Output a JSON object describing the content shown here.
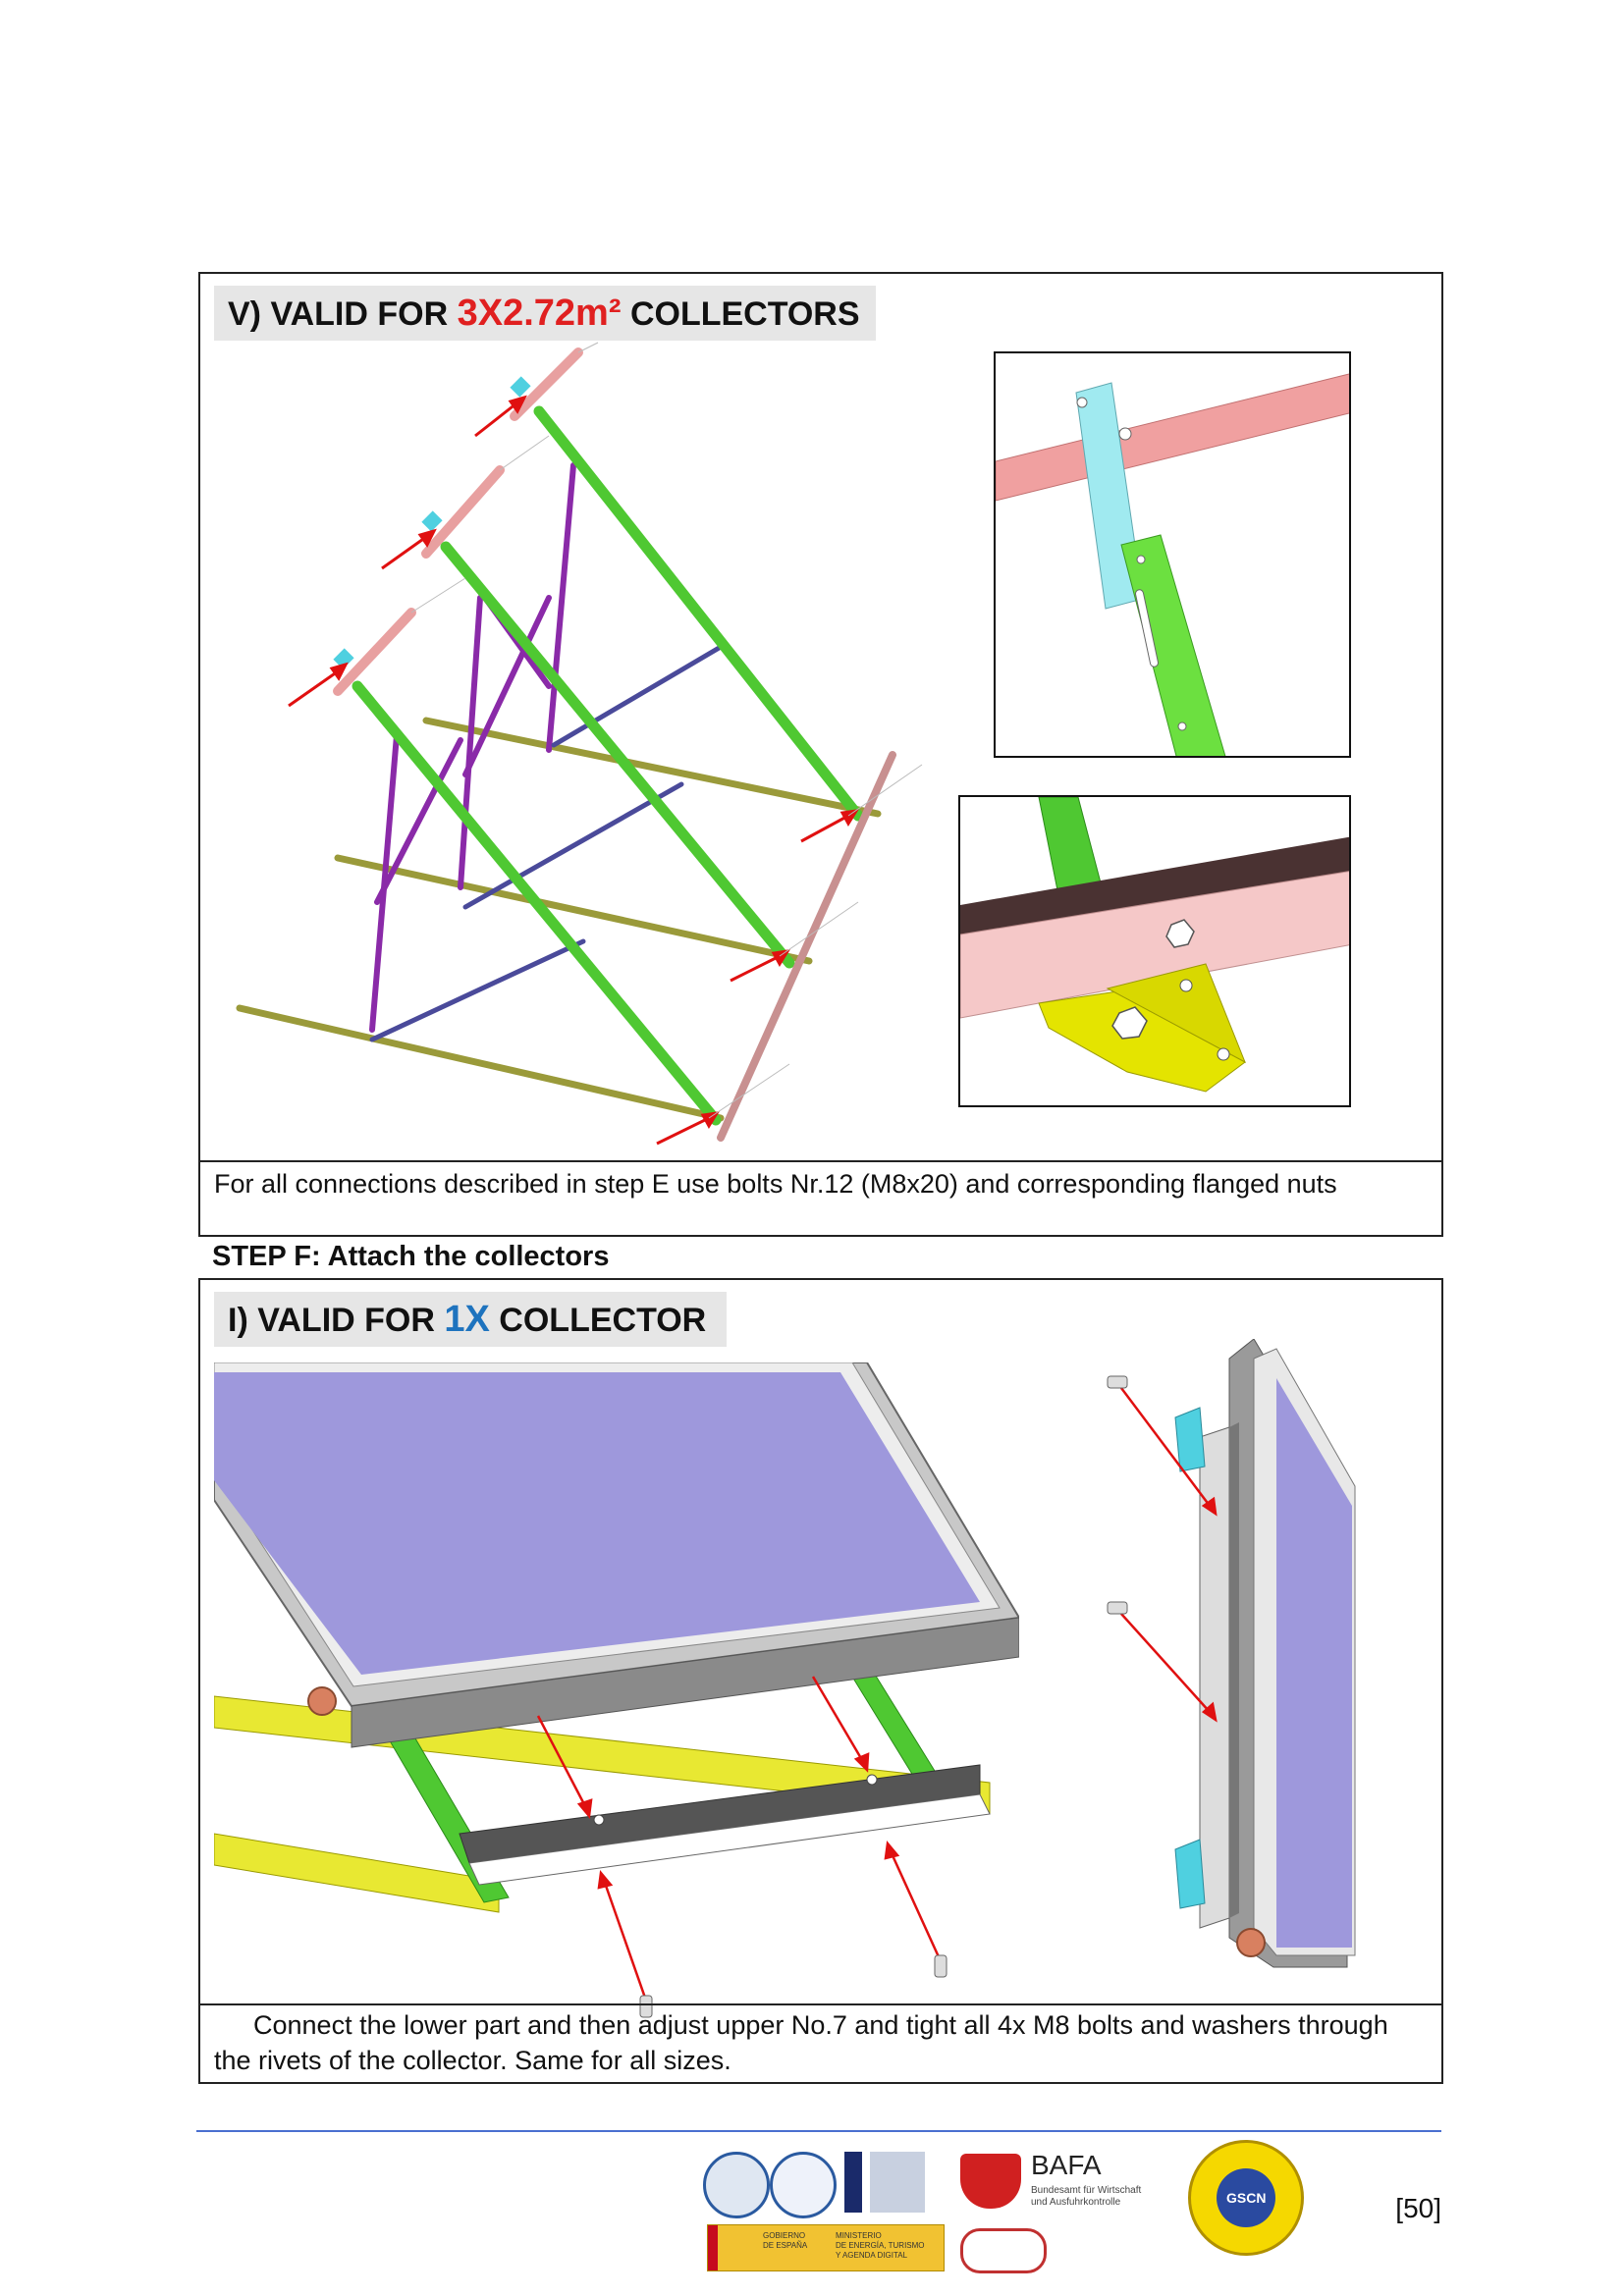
{
  "section_v": {
    "heading_prefix": "V) VALID FOR",
    "heading_highlight": "3X2.72m²",
    "heading_suffix": "COLLECTORS",
    "caption": "For all connections described in step E use bolts Nr.12 (M8x20) and corresponding flanged nuts",
    "highlight_color": "#e02020"
  },
  "step_f": {
    "title": "STEP F: Attach the collectors"
  },
  "section_i": {
    "heading_prefix": "I) VALID FOR",
    "heading_highlight": "1X",
    "heading_suffix": "COLLECTOR",
    "caption": "Connect the lower part and then adjust upper No.7 and tight all 4x M8 bolts and washers through the rivets of the collector. Same for all sizes.",
    "highlight_color": "#1e73be"
  },
  "footer": {
    "page_number": "[50]",
    "bafa_title": "BAFA",
    "bafa_subtitle_1": "Bundesamt für Wirtschaft",
    "bafa_subtitle_2": "und Ausfuhrkontrolle",
    "ministry_line_1": "GOBIERNO",
    "ministry_line_2": "DE ESPAÑA",
    "ministry_line_3": "MINISTERIO",
    "ministry_line_4": "DE ENERGÍA, TURISMO",
    "ministry_line_5": "Y AGENDA DIGITAL",
    "gscn_label": "GSCN"
  },
  "colors": {
    "frame_green": "#4fc832",
    "brace_purple": "#8a2aa8",
    "rail_olive": "#9a9a3a",
    "rail_pink": "#e8a0a0",
    "bracket_cyan": "#4fd0e0",
    "panel_violet": "#9e98dc",
    "rail_yellow": "#e8e832",
    "arrow_red": "#e01010"
  }
}
